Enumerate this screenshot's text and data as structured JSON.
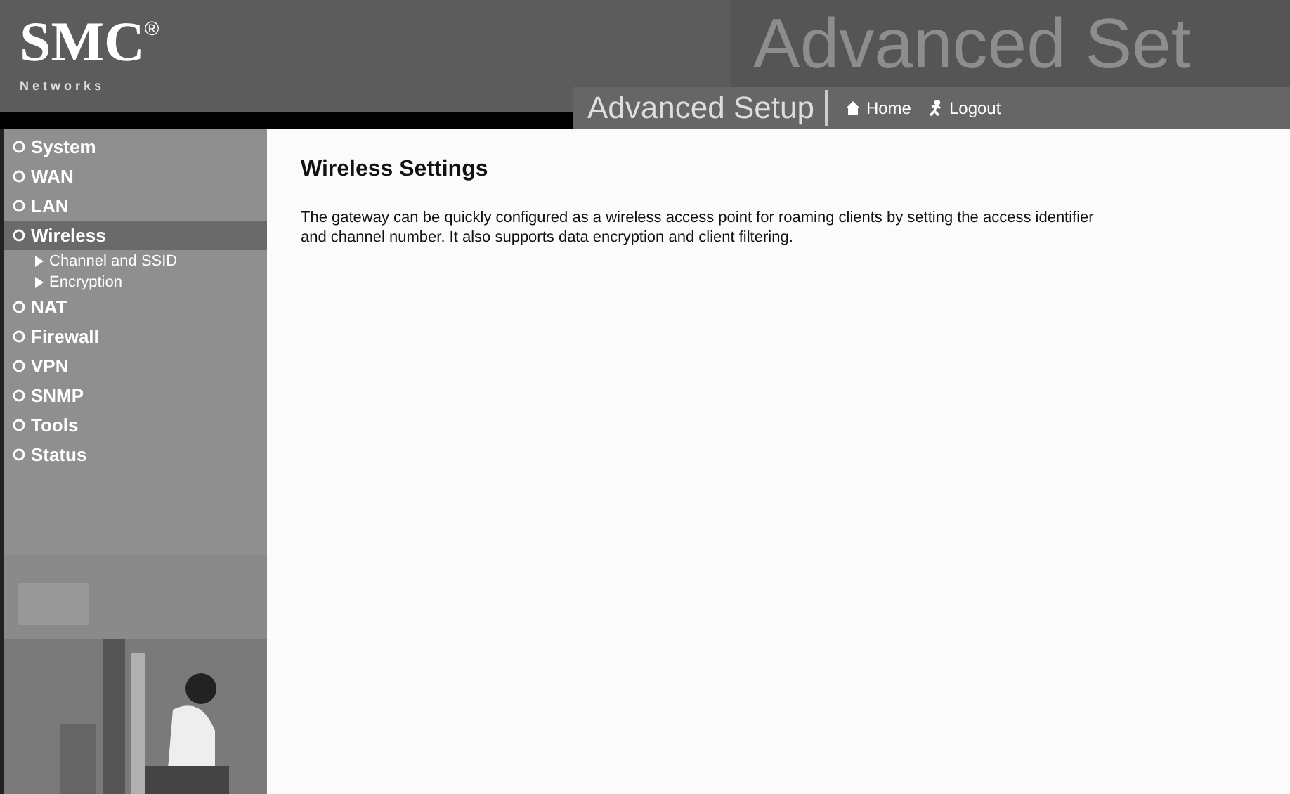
{
  "header": {
    "logo": "SMC",
    "logo_mark": "®",
    "logo_subtitle": "N e t w o r k s",
    "banner_text": "Advanced Set",
    "page_title": "Advanced Setup",
    "links": [
      {
        "label": "Home",
        "kind": "home"
      },
      {
        "label": "Logout",
        "kind": "logout"
      }
    ]
  },
  "sidebar": {
    "items": [
      {
        "label": "System",
        "selected": false
      },
      {
        "label": "WAN",
        "selected": false
      },
      {
        "label": "LAN",
        "selected": false
      },
      {
        "label": "Wireless",
        "selected": true,
        "children": [
          {
            "label": "Channel and SSID",
            "selected": false
          },
          {
            "label": "Encryption",
            "selected": false
          }
        ]
      },
      {
        "label": "NAT",
        "selected": false
      },
      {
        "label": "Firewall",
        "selected": false
      },
      {
        "label": "VPN",
        "selected": false
      },
      {
        "label": "SNMP",
        "selected": false
      },
      {
        "label": "Tools",
        "selected": false
      },
      {
        "label": "Status",
        "selected": false
      }
    ]
  },
  "content": {
    "title": "Wireless Settings",
    "description": "The gateway can be quickly configured as a wireless access point for roaming clients by setting the access identifier and channel number. It also supports data encryption and client filtering."
  }
}
